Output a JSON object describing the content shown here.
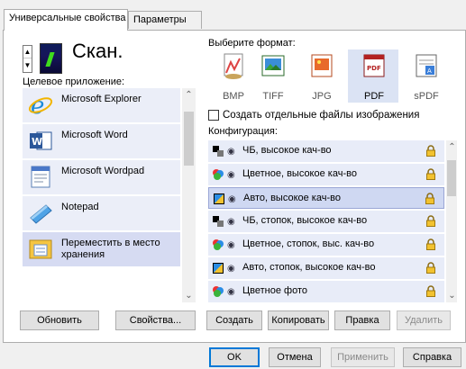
{
  "tabs": [
    {
      "label": "Универсальные свойства",
      "active": true
    },
    {
      "label": "Параметры",
      "active": false
    }
  ],
  "scan": {
    "name": "Скан."
  },
  "target_app": {
    "label": "Целевое приложение:",
    "items": [
      {
        "label": "Microsoft Explorer",
        "icon": "internet-explorer-icon"
      },
      {
        "label": "Microsoft Word",
        "icon": "word-icon"
      },
      {
        "label": "Microsoft Wordpad",
        "icon": "wordpad-icon"
      },
      {
        "label": "Notepad",
        "icon": "notepad-icon"
      },
      {
        "label": "Переместить в место хранения",
        "icon": "storage-folder-icon",
        "selected": true
      }
    ]
  },
  "format": {
    "label": "Выберите формат:",
    "items": [
      "BMP",
      "TIFF",
      "JPG",
      "PDF",
      "sPDF"
    ],
    "selected": "PDF"
  },
  "separate_files": {
    "label": "Создать отдельные файлы изображения",
    "checked": false
  },
  "config": {
    "label": "Конфигурация:",
    "items": [
      {
        "label": "ЧБ, высокое кач-во",
        "icon": "bw-icon"
      },
      {
        "label": "Цветное, высокое кач-во",
        "icon": "color-icon"
      },
      {
        "label": "Авто, высокое кач-во",
        "icon": "auto-icon",
        "selected": true
      },
      {
        "label": "ЧБ, стопок, высокое кач-во",
        "icon": "bw-icon"
      },
      {
        "label": "Цветное, стопок, выс. кач-во",
        "icon": "color-icon"
      },
      {
        "label": "Авто, стопок, высокое кач-во",
        "icon": "auto-icon"
      },
      {
        "label": "Цветное фото",
        "icon": "color-icon"
      }
    ]
  },
  "buttons": {
    "refresh": "Обновить",
    "properties": "Свойства...",
    "create": "Создать",
    "copy": "Копировать",
    "edit": "Правка",
    "delete": "Удалить"
  },
  "dialog_buttons": {
    "ok": "OK",
    "cancel": "Отмена",
    "apply": "Применить",
    "help": "Справка"
  },
  "colors": {
    "selection": "#d6dbf2",
    "item_bg": "#ebeef8",
    "accent": "#0078d7"
  }
}
